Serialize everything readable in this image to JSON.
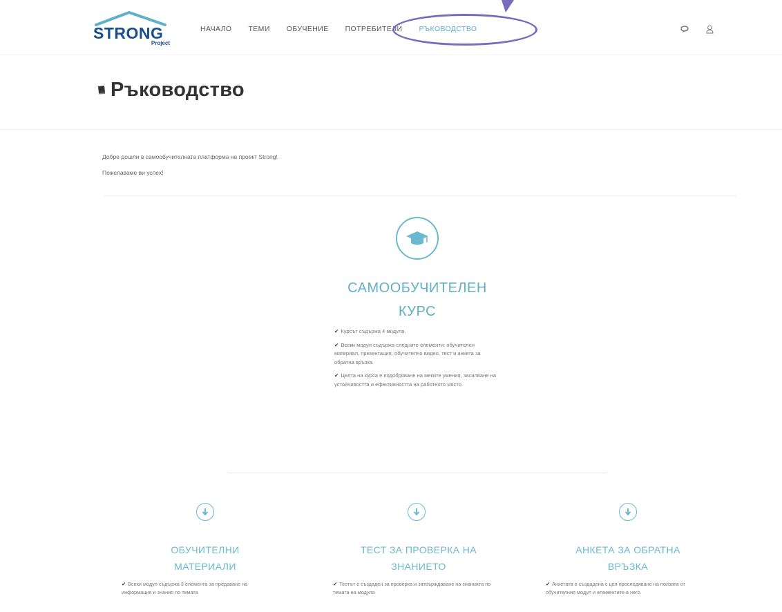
{
  "header": {
    "logo": {
      "text": "STRONG",
      "subtext": "Project"
    },
    "nav": [
      {
        "label": "НАЧАЛО",
        "active": false
      },
      {
        "label": "ТЕМИ",
        "active": false
      },
      {
        "label": "ОБУЧЕНИЕ",
        "active": false
      },
      {
        "label": "ПОТРЕБИТЕЛИ",
        "active": false
      },
      {
        "label": "РЪКОВОДСТВО",
        "active": true
      }
    ],
    "icons": [
      "chat-icon",
      "user-icon"
    ]
  },
  "page": {
    "title": "Ръководство",
    "title_icon": "book-icon"
  },
  "intro": {
    "line1": "Добре дошли в самообучителната платформа на проект Strong!",
    "line2": "Пожелаваме ви успех!"
  },
  "course": {
    "icon": "graduation-cap-icon",
    "title_line1": "САМООБУЧИТЕЛЕН",
    "title_line2": "КУРС",
    "items": [
      "Курсът съдържа 4 модула.",
      "Всеки модул съдържа следните елементи: обучителен материал, презентация, обучително видео, тест и анкета за обратна връзка.",
      "Целта на курса е подобряване на меките умения, засилване на устойчивостта и ефективността на работното място."
    ]
  },
  "columns": [
    {
      "icon": "arrow-down-circle-icon",
      "title_line1": "ОБУЧИТЕЛНИ",
      "title_line2": "МАТЕРИАЛИ",
      "text": "Всеки модул съдържа 3 елемента за предаване на информация и знания по темата"
    },
    {
      "icon": "arrow-down-circle-icon",
      "title_line1": "ТЕСТ ЗА ПРОВЕРКА НА",
      "title_line2": "ЗНАНИЕТО",
      "text": "Тестът е създаден за проверка и затвърждаване на знанията по темата на модула"
    },
    {
      "icon": "arrow-down-circle-icon",
      "title_line1": "АНКЕТА ЗА ОБРАТНА",
      "title_line2": "ВРЪЗКА",
      "text": "Анкетата е създадена с цел проследяване на ползата от обучителния модул и елементите в него."
    }
  ],
  "colors": {
    "accent": "#5fb0c9",
    "logo": "#1a4d8c",
    "highlight": "#7a6bbf"
  }
}
